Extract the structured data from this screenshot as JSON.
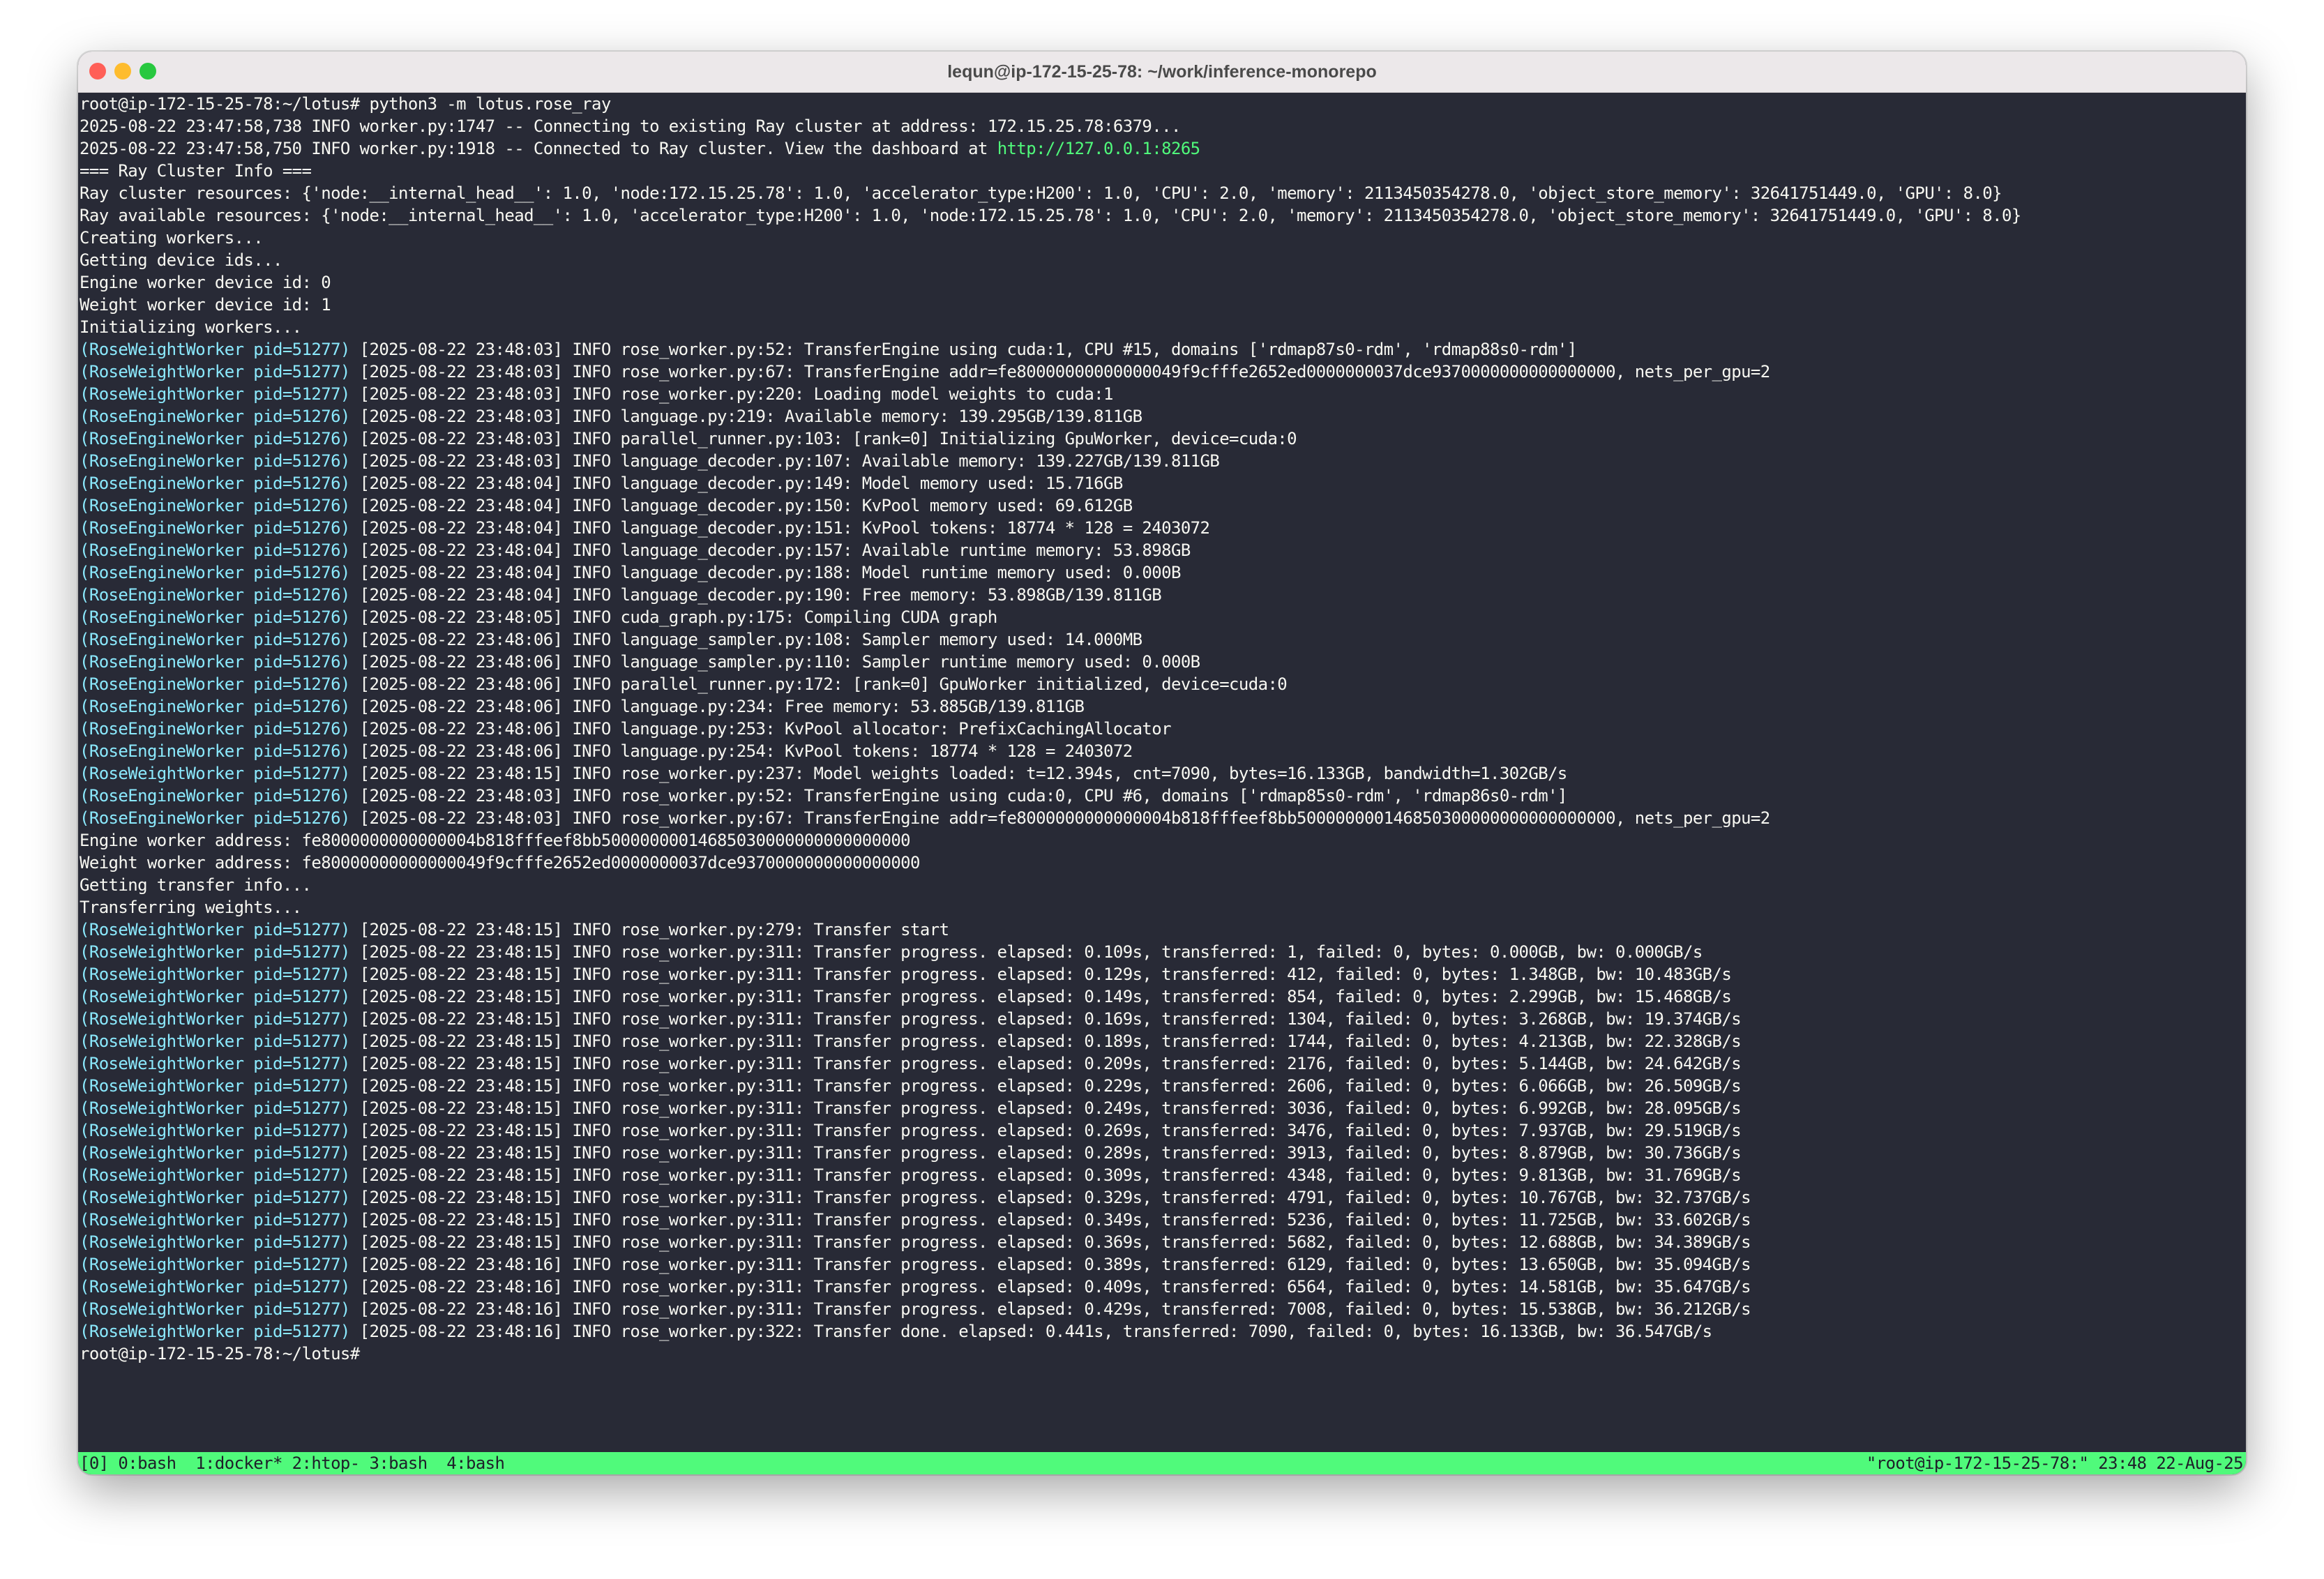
{
  "window": {
    "title": "lequn@ip-172-15-25-78: ~/work/inference-monorepo"
  },
  "colors": {
    "terminal_bg": "#282a36",
    "terminal_fg": "#f8f8f2",
    "worker_prefix": "#8be9fd",
    "link": "#50fa7b",
    "statusbar_bg": "#50fa7b"
  },
  "terminal": {
    "pre_lines": [
      "root@ip-172-15-25-78:~/lotus# python3 -m lotus.rose_ray",
      "2025-08-22 23:47:58,738 INFO worker.py:1747 -- Connecting to existing Ray cluster at address: 172.15.25.78:6379...",
      "=== Ray Cluster Info ===",
      "Ray cluster resources: {'node:__internal_head__': 1.0, 'node:172.15.25.78': 1.0, 'accelerator_type:H200': 1.0, 'CPU': 2.0, 'memory': 2113450354278.0, 'object_store_memory': 32641751449.0, 'GPU': 8.0}",
      "Ray available resources: {'node:__internal_head__': 1.0, 'accelerator_type:H200': 1.0, 'node:172.15.25.78': 1.0, 'CPU': 2.0, 'memory': 2113450354278.0, 'object_store_memory': 32641751449.0, 'GPU': 8.0}",
      "Creating workers...",
      "Getting device ids...",
      "Engine worker device id: 0",
      "Weight worker device id: 1",
      "Initializing workers..."
    ],
    "dashboard_line": {
      "text": "2025-08-22 23:47:58,750 INFO worker.py:1918 -- Connected to Ray cluster. View the dashboard at ",
      "link": "http://127.0.0.1:8265"
    },
    "init_lines": [
      {
        "prefix": "(RoseWeightWorker pid=51277)",
        "text": " [2025-08-22 23:48:03] INFO rose_worker.py:52: TransferEngine using cuda:1, CPU #15, domains ['rdmap87s0-rdm', 'rdmap88s0-rdm']"
      },
      {
        "prefix": "(RoseWeightWorker pid=51277)",
        "text": " [2025-08-22 23:48:03] INFO rose_worker.py:67: TransferEngine addr=fe80000000000000049f9cfffe2652ed0000000037dce9370000000000000000, nets_per_gpu=2"
      },
      {
        "prefix": "(RoseWeightWorker pid=51277)",
        "text": " [2025-08-22 23:48:03] INFO rose_worker.py:220: Loading model weights to cuda:1"
      },
      {
        "prefix": "(RoseEngineWorker pid=51276)",
        "text": " [2025-08-22 23:48:03] INFO language.py:219: Available memory: 139.295GB/139.811GB"
      },
      {
        "prefix": "(RoseEngineWorker pid=51276)",
        "text": " [2025-08-22 23:48:03] INFO parallel_runner.py:103: [rank=0] Initializing GpuWorker, device=cuda:0"
      },
      {
        "prefix": "(RoseEngineWorker pid=51276)",
        "text": " [2025-08-22 23:48:03] INFO language_decoder.py:107: Available memory: 139.227GB/139.811GB"
      },
      {
        "prefix": "(RoseEngineWorker pid=51276)",
        "text": " [2025-08-22 23:48:04] INFO language_decoder.py:149: Model memory used: 15.716GB"
      },
      {
        "prefix": "(RoseEngineWorker pid=51276)",
        "text": " [2025-08-22 23:48:04] INFO language_decoder.py:150: KvPool memory used: 69.612GB"
      },
      {
        "prefix": "(RoseEngineWorker pid=51276)",
        "text": " [2025-08-22 23:48:04] INFO language_decoder.py:151: KvPool tokens: 18774 * 128 = 2403072"
      },
      {
        "prefix": "(RoseEngineWorker pid=51276)",
        "text": " [2025-08-22 23:48:04] INFO language_decoder.py:157: Available runtime memory: 53.898GB"
      },
      {
        "prefix": "(RoseEngineWorker pid=51276)",
        "text": " [2025-08-22 23:48:04] INFO language_decoder.py:188: Model runtime memory used: 0.000B"
      },
      {
        "prefix": "(RoseEngineWorker pid=51276)",
        "text": " [2025-08-22 23:48:04] INFO language_decoder.py:190: Free memory: 53.898GB/139.811GB"
      },
      {
        "prefix": "(RoseEngineWorker pid=51276)",
        "text": " [2025-08-22 23:48:05] INFO cuda_graph.py:175: Compiling CUDA graph"
      },
      {
        "prefix": "(RoseEngineWorker pid=51276)",
        "text": " [2025-08-22 23:48:06] INFO language_sampler.py:108: Sampler memory used: 14.000MB"
      },
      {
        "prefix": "(RoseEngineWorker pid=51276)",
        "text": " [2025-08-22 23:48:06] INFO language_sampler.py:110: Sampler runtime memory used: 0.000B"
      },
      {
        "prefix": "(RoseEngineWorker pid=51276)",
        "text": " [2025-08-22 23:48:06] INFO parallel_runner.py:172: [rank=0] GpuWorker initialized, device=cuda:0"
      },
      {
        "prefix": "(RoseEngineWorker pid=51276)",
        "text": " [2025-08-22 23:48:06] INFO language.py:234: Free memory: 53.885GB/139.811GB"
      },
      {
        "prefix": "(RoseEngineWorker pid=51276)",
        "text": " [2025-08-22 23:48:06] INFO language.py:253: KvPool allocator: PrefixCachingAllocator"
      },
      {
        "prefix": "(RoseEngineWorker pid=51276)",
        "text": " [2025-08-22 23:48:06] INFO language.py:254: KvPool tokens: 18774 * 128 = 2403072"
      },
      {
        "prefix": "(RoseWeightWorker pid=51277)",
        "text": " [2025-08-22 23:48:15] INFO rose_worker.py:237: Model weights loaded: t=12.394s, cnt=7090, bytes=16.133GB, bandwidth=1.302GB/s"
      },
      {
        "prefix": "(RoseEngineWorker pid=51276)",
        "text": " [2025-08-22 23:48:03] INFO rose_worker.py:52: TransferEngine using cuda:0, CPU #6, domains ['rdmap85s0-rdm', 'rdmap86s0-rdm']"
      },
      {
        "prefix": "(RoseEngineWorker pid=51276)",
        "text": " [2025-08-22 23:48:03] INFO rose_worker.py:67: TransferEngine addr=fe8000000000000004b818fffeef8bb500000000146850300000000000000000, nets_per_gpu=2"
      }
    ],
    "mid_lines": [
      "Engine worker address: fe8000000000000004b818fffeef8bb50000000014685030000000000000000",
      "Weight worker address: fe80000000000000049f9cfffe2652ed0000000037dce9370000000000000000",
      "Getting transfer info...",
      "Transferring weights..."
    ],
    "transfer_lines": [
      {
        "prefix": "(RoseWeightWorker pid=51277)",
        "text": " [2025-08-22 23:48:15] INFO rose_worker.py:279: Transfer start"
      },
      {
        "prefix": "(RoseWeightWorker pid=51277)",
        "text": " [2025-08-22 23:48:15] INFO rose_worker.py:311: Transfer progress. elapsed: 0.109s, transferred: 1, failed: 0, bytes: 0.000GB, bw: 0.000GB/s"
      },
      {
        "prefix": "(RoseWeightWorker pid=51277)",
        "text": " [2025-08-22 23:48:15] INFO rose_worker.py:311: Transfer progress. elapsed: 0.129s, transferred: 412, failed: 0, bytes: 1.348GB, bw: 10.483GB/s"
      },
      {
        "prefix": "(RoseWeightWorker pid=51277)",
        "text": " [2025-08-22 23:48:15] INFO rose_worker.py:311: Transfer progress. elapsed: 0.149s, transferred: 854, failed: 0, bytes: 2.299GB, bw: 15.468GB/s"
      },
      {
        "prefix": "(RoseWeightWorker pid=51277)",
        "text": " [2025-08-22 23:48:15] INFO rose_worker.py:311: Transfer progress. elapsed: 0.169s, transferred: 1304, failed: 0, bytes: 3.268GB, bw: 19.374GB/s"
      },
      {
        "prefix": "(RoseWeightWorker pid=51277)",
        "text": " [2025-08-22 23:48:15] INFO rose_worker.py:311: Transfer progress. elapsed: 0.189s, transferred: 1744, failed: 0, bytes: 4.213GB, bw: 22.328GB/s"
      },
      {
        "prefix": "(RoseWeightWorker pid=51277)",
        "text": " [2025-08-22 23:48:15] INFO rose_worker.py:311: Transfer progress. elapsed: 0.209s, transferred: 2176, failed: 0, bytes: 5.144GB, bw: 24.642GB/s"
      },
      {
        "prefix": "(RoseWeightWorker pid=51277)",
        "text": " [2025-08-22 23:48:15] INFO rose_worker.py:311: Transfer progress. elapsed: 0.229s, transferred: 2606, failed: 0, bytes: 6.066GB, bw: 26.509GB/s"
      },
      {
        "prefix": "(RoseWeightWorker pid=51277)",
        "text": " [2025-08-22 23:48:15] INFO rose_worker.py:311: Transfer progress. elapsed: 0.249s, transferred: 3036, failed: 0, bytes: 6.992GB, bw: 28.095GB/s"
      },
      {
        "prefix": "(RoseWeightWorker pid=51277)",
        "text": " [2025-08-22 23:48:15] INFO rose_worker.py:311: Transfer progress. elapsed: 0.269s, transferred: 3476, failed: 0, bytes: 7.937GB, bw: 29.519GB/s"
      },
      {
        "prefix": "(RoseWeightWorker pid=51277)",
        "text": " [2025-08-22 23:48:15] INFO rose_worker.py:311: Transfer progress. elapsed: 0.289s, transferred: 3913, failed: 0, bytes: 8.879GB, bw: 30.736GB/s"
      },
      {
        "prefix": "(RoseWeightWorker pid=51277)",
        "text": " [2025-08-22 23:48:15] INFO rose_worker.py:311: Transfer progress. elapsed: 0.309s, transferred: 4348, failed: 0, bytes: 9.813GB, bw: 31.769GB/s"
      },
      {
        "prefix": "(RoseWeightWorker pid=51277)",
        "text": " [2025-08-22 23:48:15] INFO rose_worker.py:311: Transfer progress. elapsed: 0.329s, transferred: 4791, failed: 0, bytes: 10.767GB, bw: 32.737GB/s"
      },
      {
        "prefix": "(RoseWeightWorker pid=51277)",
        "text": " [2025-08-22 23:48:15] INFO rose_worker.py:311: Transfer progress. elapsed: 0.349s, transferred: 5236, failed: 0, bytes: 11.725GB, bw: 33.602GB/s"
      },
      {
        "prefix": "(RoseWeightWorker pid=51277)",
        "text": " [2025-08-22 23:48:15] INFO rose_worker.py:311: Transfer progress. elapsed: 0.369s, transferred: 5682, failed: 0, bytes: 12.688GB, bw: 34.389GB/s"
      },
      {
        "prefix": "(RoseWeightWorker pid=51277)",
        "text": " [2025-08-22 23:48:16] INFO rose_worker.py:311: Transfer progress. elapsed: 0.389s, transferred: 6129, failed: 0, bytes: 13.650GB, bw: 35.094GB/s"
      },
      {
        "prefix": "(RoseWeightWorker pid=51277)",
        "text": " [2025-08-22 23:48:16] INFO rose_worker.py:311: Transfer progress. elapsed: 0.409s, transferred: 6564, failed: 0, bytes: 14.581GB, bw: 35.647GB/s"
      },
      {
        "prefix": "(RoseWeightWorker pid=51277)",
        "text": " [2025-08-22 23:48:16] INFO rose_worker.py:311: Transfer progress. elapsed: 0.429s, transferred: 7008, failed: 0, bytes: 15.538GB, bw: 36.212GB/s"
      },
      {
        "prefix": "(RoseWeightWorker pid=51277)",
        "text": " [2025-08-22 23:48:16] INFO rose_worker.py:322: Transfer done. elapsed: 0.441s, transferred: 7090, failed: 0, bytes: 16.133GB, bw: 36.547GB/s"
      }
    ],
    "final_prompt": "root@ip-172-15-25-78:~/lotus# "
  },
  "statusbar": {
    "left": "[0] 0:bash  1:docker* 2:htop- 3:bash  4:bash",
    "right": "\"root@ip-172-15-25-78:\" 23:48 22-Aug-25"
  }
}
